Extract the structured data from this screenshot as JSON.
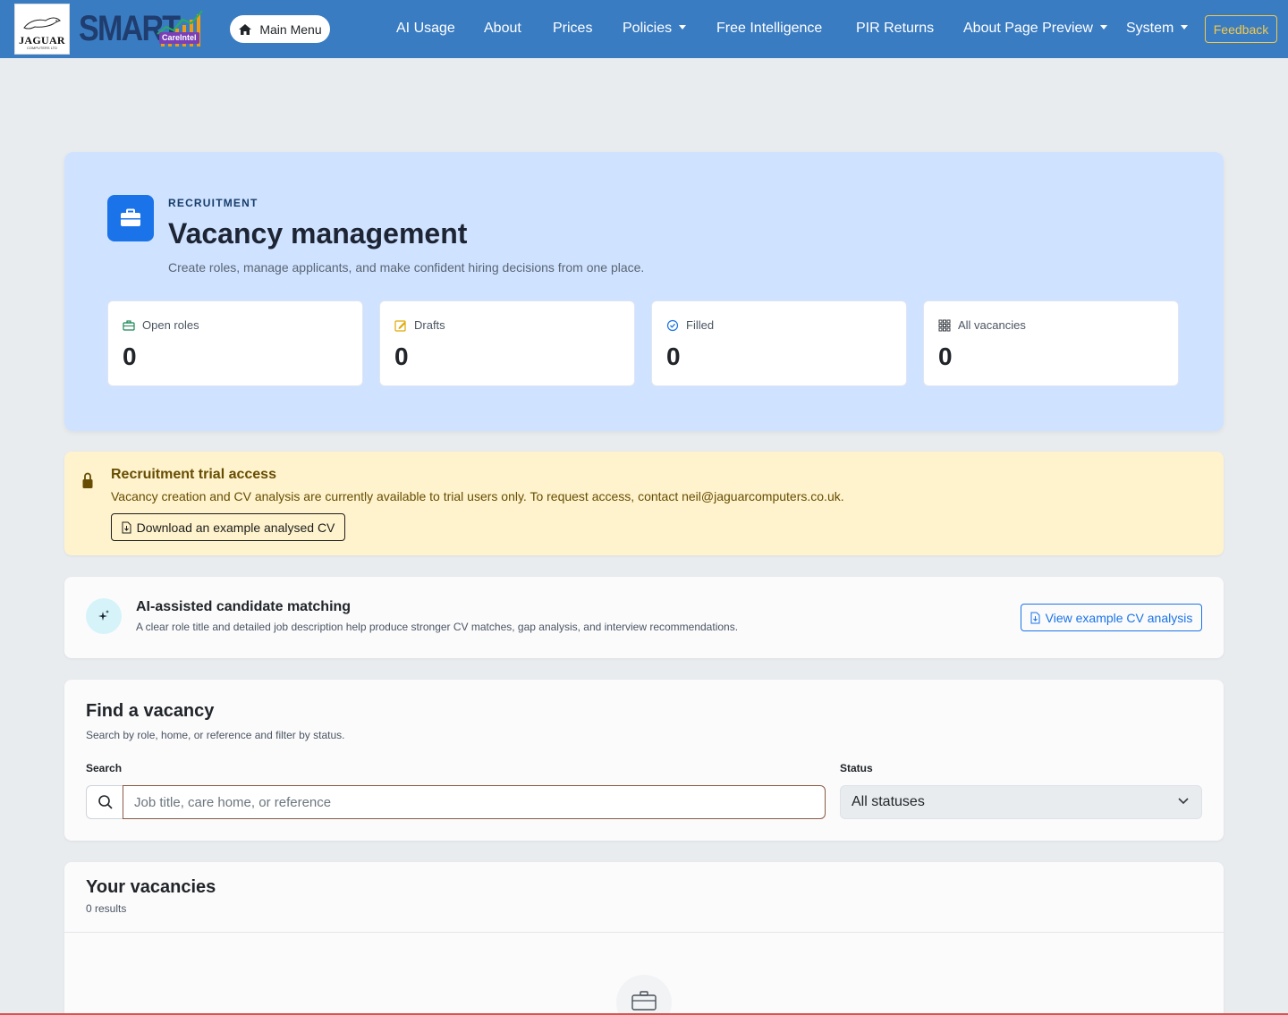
{
  "navbar": {
    "logo_jaguar_text": "JAGUAR",
    "logo_jaguar_sub": "COMPUTERS LTD",
    "logo_smart_text": "SMART",
    "logo_badge": "CareIntel",
    "main_menu_label": "Main Menu",
    "links": [
      {
        "label": "AI Usage",
        "dropdown": false
      },
      {
        "label": "About",
        "dropdown": false
      },
      {
        "label": "Prices",
        "dropdown": false
      },
      {
        "label": "Policies",
        "dropdown": true
      },
      {
        "label": "Free Intelligence",
        "dropdown": false
      },
      {
        "label": "PIR Returns",
        "dropdown": false
      },
      {
        "label": "About Page Preview",
        "dropdown": true
      },
      {
        "label": "System",
        "dropdown": true
      }
    ],
    "feedback_label": "Feedback",
    "colors": {
      "bar": "#3a7cc2",
      "feedback": "#f2c94c"
    }
  },
  "hero": {
    "eyebrow": "RECRUITMENT",
    "title": "Vacancy management",
    "subtitle": "Create roles, manage applicants, and make confident hiring decisions from one place.",
    "icon": "briefcase-icon",
    "stats": [
      {
        "label": "Open roles",
        "value": "0",
        "icon": "briefcase-outline-icon",
        "color": "#198754"
      },
      {
        "label": "Drafts",
        "value": "0",
        "icon": "pencil-square-icon",
        "color": "#e0a800"
      },
      {
        "label": "Filled",
        "value": "0",
        "icon": "check-badge-icon",
        "color": "#1a73e8"
      },
      {
        "label": "All vacancies",
        "value": "0",
        "icon": "grid-icon",
        "color": "#343a40"
      }
    ]
  },
  "trial": {
    "title": "Recruitment trial access",
    "text": "Vacancy creation and CV analysis are currently available to trial users only. To request access, contact neil@jaguarcomputers.co.uk.",
    "button_label": "Download an example analysed CV"
  },
  "ai_card": {
    "title": "AI-assisted candidate matching",
    "text": "A clear role title and detailed job description help produce stronger CV matches, gap analysis, and interview recommendations.",
    "button_label": "View example CV analysis"
  },
  "find": {
    "title": "Find a vacancy",
    "subtitle": "Search by role, home, or reference and filter by status.",
    "search_label": "Search",
    "search_placeholder": "Job title, care home, or reference",
    "search_value": "",
    "status_label": "Status",
    "status_selected": "All statuses"
  },
  "vacancies": {
    "title": "Your vacancies",
    "count_text": "0 results"
  }
}
